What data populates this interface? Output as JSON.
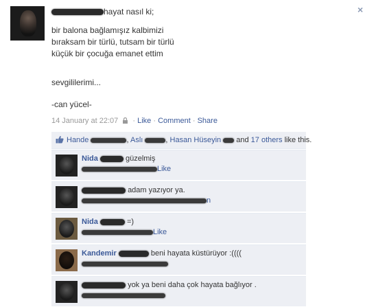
{
  "close_label": "×",
  "post": {
    "header_text": "hayat nasıl ki;",
    "poem_lines": [
      "bir balona bağlamışız kalbimizi",
      "bıraksam bir türlü, tutsam bir türlü",
      "küçük bir çocuğa emanet ettim"
    ],
    "line_2": "sevgililerimi...",
    "signature": "-can yücel-",
    "timestamp": "14 January at 22:07",
    "sep": "·",
    "like": "Like",
    "comment": "Comment",
    "share": "Share"
  },
  "likes": {
    "name1": "Hande",
    "comma1": ",",
    "name2": "Aslı",
    "comma2": ",",
    "name3": "Hasan Hüseyin",
    "and_text": "and",
    "others": "17 others",
    "suffix": "like this."
  },
  "comments": [
    {
      "author": "Nida",
      "text": "güzelmiş",
      "action": "Like"
    },
    {
      "author": "",
      "text": "adam yazıyor ya.",
      "action": "n"
    },
    {
      "author": "Nida",
      "text": "=)",
      "action": "Like"
    },
    {
      "author": "Kandemir",
      "text": "beni hayata küstürüyor :((((",
      "action": ""
    },
    {
      "author": "",
      "text": "yok ya beni daha çok hayata bağlıyor .",
      "action": ""
    }
  ],
  "colors": {
    "link": "#3b5998",
    "feedback_bg": "#edeff4",
    "meta": "#999999"
  }
}
